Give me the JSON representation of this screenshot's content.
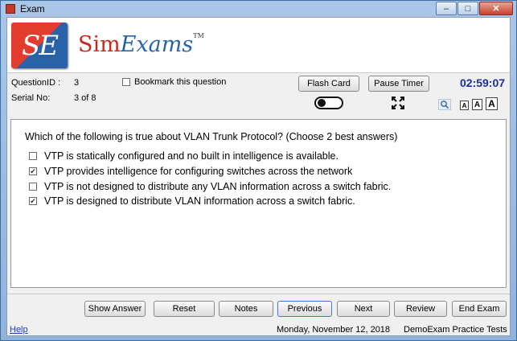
{
  "window": {
    "title": "Exam",
    "minimize": "–",
    "maximize": "□",
    "close": "✕"
  },
  "brand": {
    "logo_letters": "SE",
    "sim": "Sim",
    "exams": "Exams",
    "tm": "TM"
  },
  "info": {
    "question_id_label": "QuestionID :",
    "question_id_value": "3",
    "serial_label": "Serial No:",
    "serial_value": "3 of 8",
    "bookmark_label": "Bookmark this question",
    "flash_card": "Flash Card",
    "pause_timer": "Pause Timer",
    "timer": "02:59:07",
    "font_sizes": [
      "A",
      "A",
      "A"
    ]
  },
  "question": {
    "text": "Which of the following is true about VLAN Trunk Protocol? (Choose 2 best answers)",
    "options": [
      {
        "label": "VTP is statically configured and no built in intelligence is available.",
        "checked": false
      },
      {
        "label": "VTP provides intelligence for configuring switches across the network",
        "checked": true
      },
      {
        "label": "VTP is not designed to distribute any VLAN information across a switch fabric.",
        "checked": false
      },
      {
        "label": "VTP is designed to distribute VLAN information across a switch fabric.",
        "checked": true
      }
    ]
  },
  "footer": {
    "show_answer": "Show Answer",
    "reset": "Reset",
    "notes": "Notes",
    "previous": "Previous",
    "next": "Next",
    "review": "Review",
    "end_exam": "End Exam"
  },
  "status": {
    "help": "Help",
    "date": "Monday, November 12, 2018",
    "product": "DemoExam Practice Tests"
  }
}
